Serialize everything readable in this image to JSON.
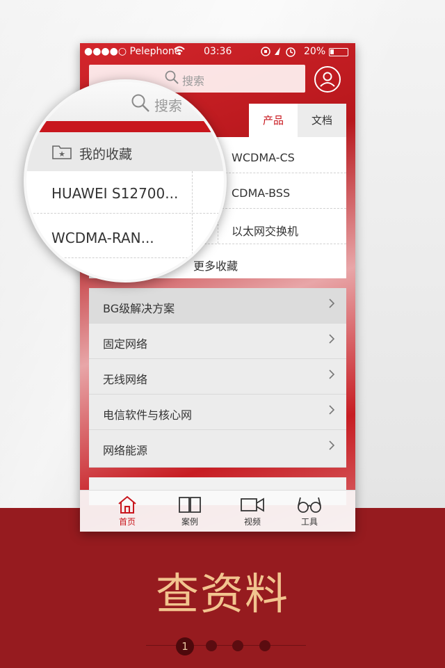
{
  "status_bar": {
    "carrier": "●●●●○ Pelephone",
    "time": "03:36",
    "battery": "20%"
  },
  "search": {
    "placeholder": "搜索"
  },
  "tabs": [
    {
      "label": "产品",
      "active": true
    },
    {
      "label": "文档",
      "active": false
    }
  ],
  "favorites": {
    "header": "我的收藏",
    "items": [
      "HUAWEI S12700...",
      "WCDMA-CS",
      "CDMA-BSS",
      "WCDMA-RAN...",
      "以太网交换机"
    ],
    "more": "更多收藏"
  },
  "menu": [
    {
      "label": "BG级解决方案"
    },
    {
      "label": "固定网络"
    },
    {
      "label": "无线网络"
    },
    {
      "label": "电信软件与核心网"
    },
    {
      "label": "网络能源"
    }
  ],
  "tabbar": [
    {
      "label": "首页",
      "icon": "home-icon",
      "active": true
    },
    {
      "label": "案例",
      "icon": "book-icon",
      "active": false
    },
    {
      "label": "视频",
      "icon": "video-camera-icon",
      "active": false
    },
    {
      "label": "工具",
      "icon": "glasses-icon",
      "active": false
    }
  ],
  "promo": {
    "headline": "查资料",
    "page_indicator": "1"
  },
  "colors": {
    "brand_red": "#c8161d",
    "band_red": "#961b1f",
    "headline": "#f2c48f"
  }
}
